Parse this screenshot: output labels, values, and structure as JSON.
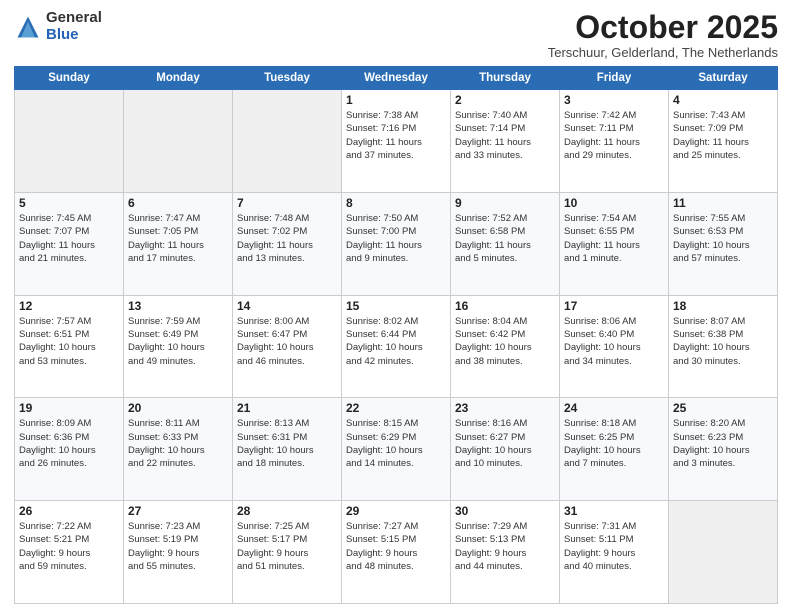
{
  "logo": {
    "general": "General",
    "blue": "Blue"
  },
  "header": {
    "month": "October 2025",
    "location": "Terschuur, Gelderland, The Netherlands"
  },
  "weekdays": [
    "Sunday",
    "Monday",
    "Tuesday",
    "Wednesday",
    "Thursday",
    "Friday",
    "Saturday"
  ],
  "weeks": [
    [
      {
        "day": "",
        "info": ""
      },
      {
        "day": "",
        "info": ""
      },
      {
        "day": "",
        "info": ""
      },
      {
        "day": "1",
        "info": "Sunrise: 7:38 AM\nSunset: 7:16 PM\nDaylight: 11 hours\nand 37 minutes."
      },
      {
        "day": "2",
        "info": "Sunrise: 7:40 AM\nSunset: 7:14 PM\nDaylight: 11 hours\nand 33 minutes."
      },
      {
        "day": "3",
        "info": "Sunrise: 7:42 AM\nSunset: 7:11 PM\nDaylight: 11 hours\nand 29 minutes."
      },
      {
        "day": "4",
        "info": "Sunrise: 7:43 AM\nSunset: 7:09 PM\nDaylight: 11 hours\nand 25 minutes."
      }
    ],
    [
      {
        "day": "5",
        "info": "Sunrise: 7:45 AM\nSunset: 7:07 PM\nDaylight: 11 hours\nand 21 minutes."
      },
      {
        "day": "6",
        "info": "Sunrise: 7:47 AM\nSunset: 7:05 PM\nDaylight: 11 hours\nand 17 minutes."
      },
      {
        "day": "7",
        "info": "Sunrise: 7:48 AM\nSunset: 7:02 PM\nDaylight: 11 hours\nand 13 minutes."
      },
      {
        "day": "8",
        "info": "Sunrise: 7:50 AM\nSunset: 7:00 PM\nDaylight: 11 hours\nand 9 minutes."
      },
      {
        "day": "9",
        "info": "Sunrise: 7:52 AM\nSunset: 6:58 PM\nDaylight: 11 hours\nand 5 minutes."
      },
      {
        "day": "10",
        "info": "Sunrise: 7:54 AM\nSunset: 6:55 PM\nDaylight: 11 hours\nand 1 minute."
      },
      {
        "day": "11",
        "info": "Sunrise: 7:55 AM\nSunset: 6:53 PM\nDaylight: 10 hours\nand 57 minutes."
      }
    ],
    [
      {
        "day": "12",
        "info": "Sunrise: 7:57 AM\nSunset: 6:51 PM\nDaylight: 10 hours\nand 53 minutes."
      },
      {
        "day": "13",
        "info": "Sunrise: 7:59 AM\nSunset: 6:49 PM\nDaylight: 10 hours\nand 49 minutes."
      },
      {
        "day": "14",
        "info": "Sunrise: 8:00 AM\nSunset: 6:47 PM\nDaylight: 10 hours\nand 46 minutes."
      },
      {
        "day": "15",
        "info": "Sunrise: 8:02 AM\nSunset: 6:44 PM\nDaylight: 10 hours\nand 42 minutes."
      },
      {
        "day": "16",
        "info": "Sunrise: 8:04 AM\nSunset: 6:42 PM\nDaylight: 10 hours\nand 38 minutes."
      },
      {
        "day": "17",
        "info": "Sunrise: 8:06 AM\nSunset: 6:40 PM\nDaylight: 10 hours\nand 34 minutes."
      },
      {
        "day": "18",
        "info": "Sunrise: 8:07 AM\nSunset: 6:38 PM\nDaylight: 10 hours\nand 30 minutes."
      }
    ],
    [
      {
        "day": "19",
        "info": "Sunrise: 8:09 AM\nSunset: 6:36 PM\nDaylight: 10 hours\nand 26 minutes."
      },
      {
        "day": "20",
        "info": "Sunrise: 8:11 AM\nSunset: 6:33 PM\nDaylight: 10 hours\nand 22 minutes."
      },
      {
        "day": "21",
        "info": "Sunrise: 8:13 AM\nSunset: 6:31 PM\nDaylight: 10 hours\nand 18 minutes."
      },
      {
        "day": "22",
        "info": "Sunrise: 8:15 AM\nSunset: 6:29 PM\nDaylight: 10 hours\nand 14 minutes."
      },
      {
        "day": "23",
        "info": "Sunrise: 8:16 AM\nSunset: 6:27 PM\nDaylight: 10 hours\nand 10 minutes."
      },
      {
        "day": "24",
        "info": "Sunrise: 8:18 AM\nSunset: 6:25 PM\nDaylight: 10 hours\nand 7 minutes."
      },
      {
        "day": "25",
        "info": "Sunrise: 8:20 AM\nSunset: 6:23 PM\nDaylight: 10 hours\nand 3 minutes."
      }
    ],
    [
      {
        "day": "26",
        "info": "Sunrise: 7:22 AM\nSunset: 5:21 PM\nDaylight: 9 hours\nand 59 minutes."
      },
      {
        "day": "27",
        "info": "Sunrise: 7:23 AM\nSunset: 5:19 PM\nDaylight: 9 hours\nand 55 minutes."
      },
      {
        "day": "28",
        "info": "Sunrise: 7:25 AM\nSunset: 5:17 PM\nDaylight: 9 hours\nand 51 minutes."
      },
      {
        "day": "29",
        "info": "Sunrise: 7:27 AM\nSunset: 5:15 PM\nDaylight: 9 hours\nand 48 minutes."
      },
      {
        "day": "30",
        "info": "Sunrise: 7:29 AM\nSunset: 5:13 PM\nDaylight: 9 hours\nand 44 minutes."
      },
      {
        "day": "31",
        "info": "Sunrise: 7:31 AM\nSunset: 5:11 PM\nDaylight: 9 hours\nand 40 minutes."
      },
      {
        "day": "",
        "info": ""
      }
    ]
  ]
}
